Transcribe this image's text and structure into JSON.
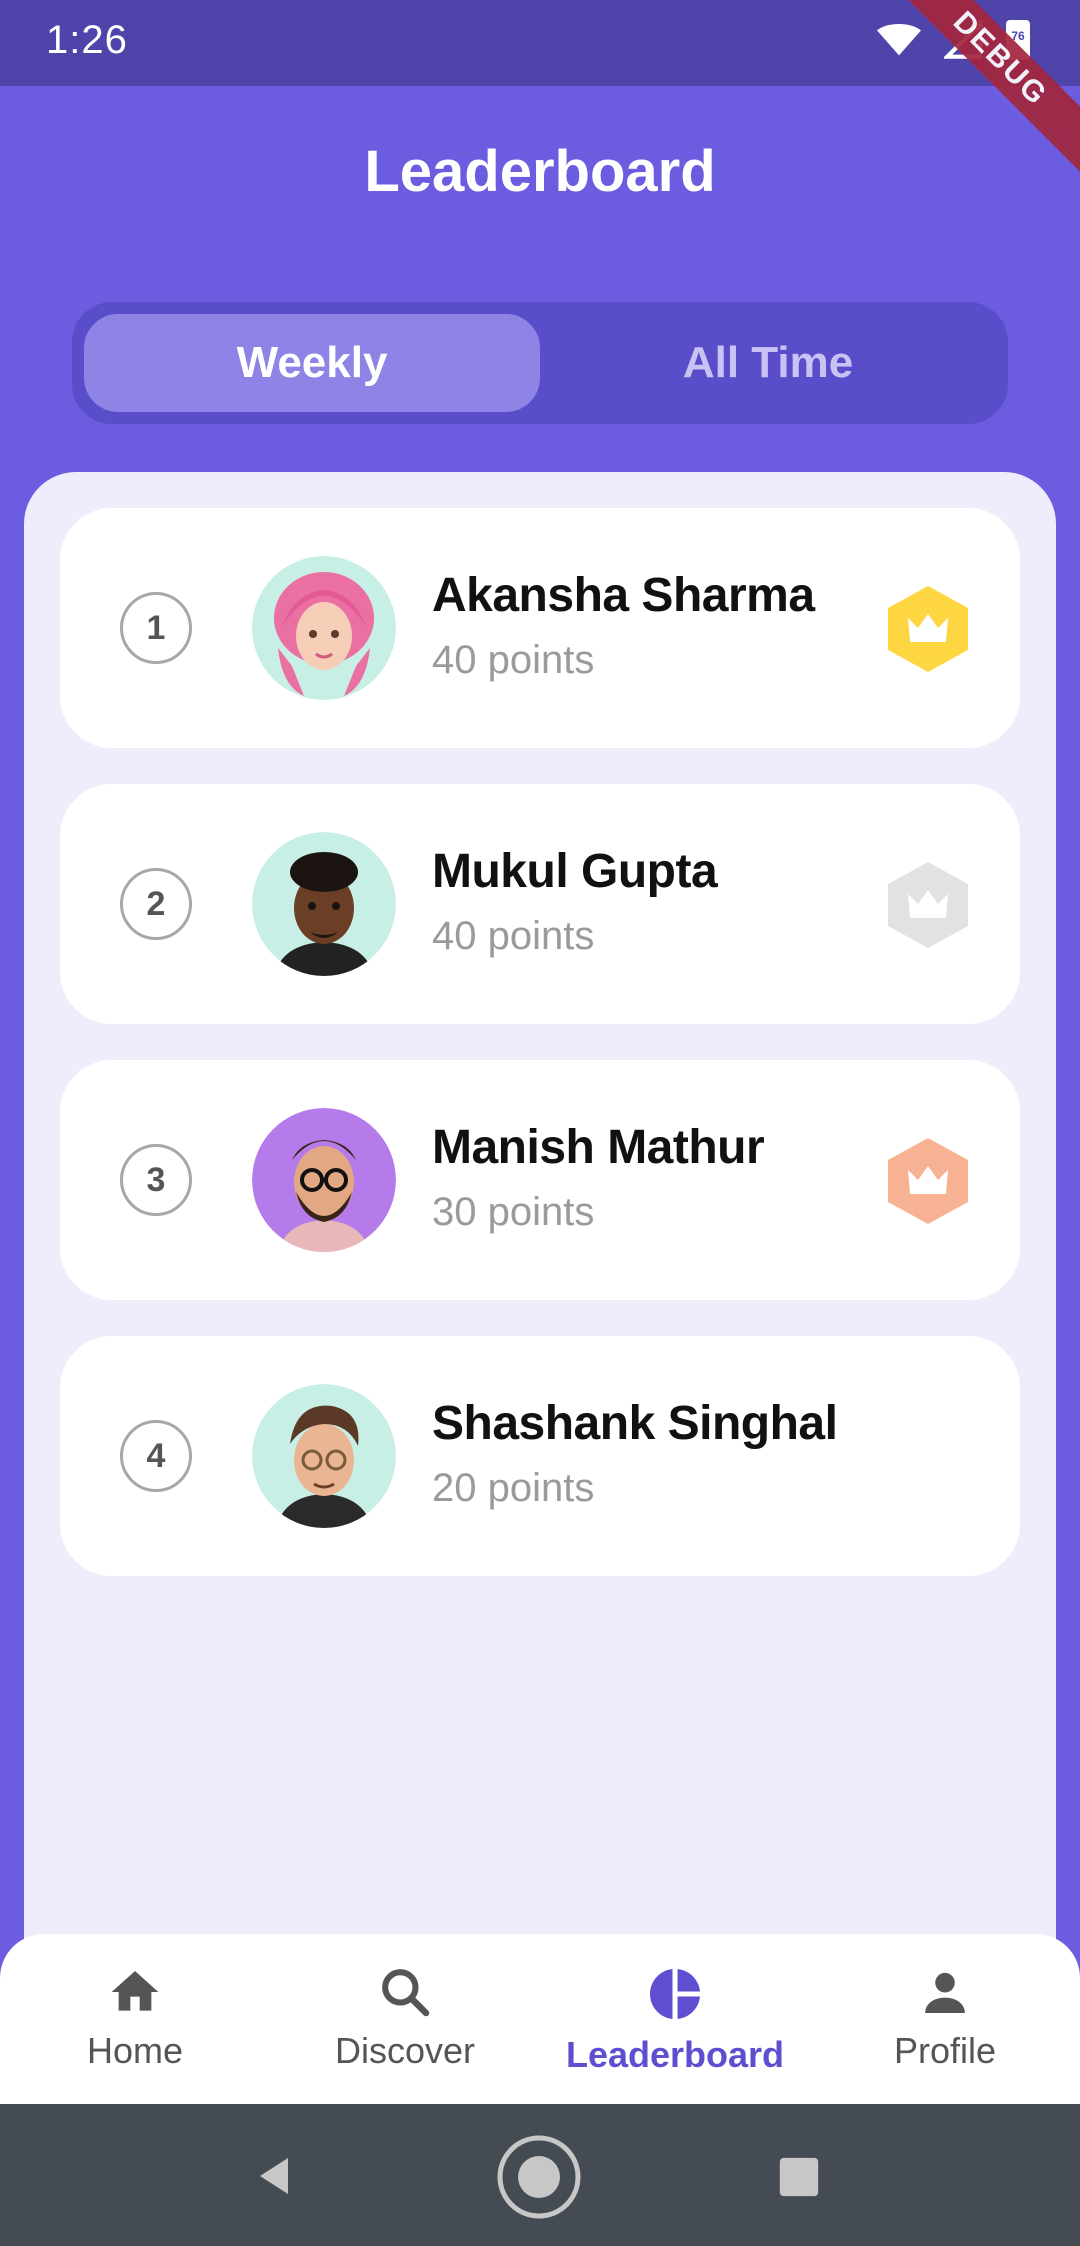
{
  "status_bar": {
    "time": "1:26",
    "battery": "76",
    "debug_label": "DEBUG"
  },
  "header": {
    "title": "Leaderboard"
  },
  "tabs": [
    {
      "label": "Weekly",
      "selected": true
    },
    {
      "label": "All Time",
      "selected": false
    }
  ],
  "leaderboard": [
    {
      "rank": "1",
      "name": "Akansha Sharma",
      "points": "40 points",
      "avatar_bg": "#C8EFE6",
      "badge": "gold-crown-icon",
      "badge_color": "#FDD642"
    },
    {
      "rank": "2",
      "name": "Mukul Gupta",
      "points": "40 points",
      "avatar_bg": "#C8EFE6",
      "badge": "silver-crown-icon",
      "badge_color": "#E2E2E2"
    },
    {
      "rank": "3",
      "name": "Manish Mathur",
      "points": "30 points",
      "avatar_bg": "#B57BEA",
      "badge": "bronze-crown-icon",
      "badge_color": "#F7B193"
    },
    {
      "rank": "4",
      "name": "Shashank Singhal",
      "points": "20 points",
      "avatar_bg": "#C8EFE6",
      "badge": "",
      "badge_color": ""
    }
  ],
  "bottom_nav": [
    {
      "label": "Home",
      "icon": "home-icon",
      "active": false
    },
    {
      "label": "Discover",
      "icon": "search-icon",
      "active": false
    },
    {
      "label": "Leaderboard",
      "icon": "pie-chart-icon",
      "active": true
    },
    {
      "label": "Profile",
      "icon": "person-icon",
      "active": false
    }
  ],
  "colors": {
    "primary": "#6C5CE0",
    "status_bar": "#4E44A9",
    "panel": "#EFEDFC",
    "active_nav": "#5D4FD0"
  }
}
